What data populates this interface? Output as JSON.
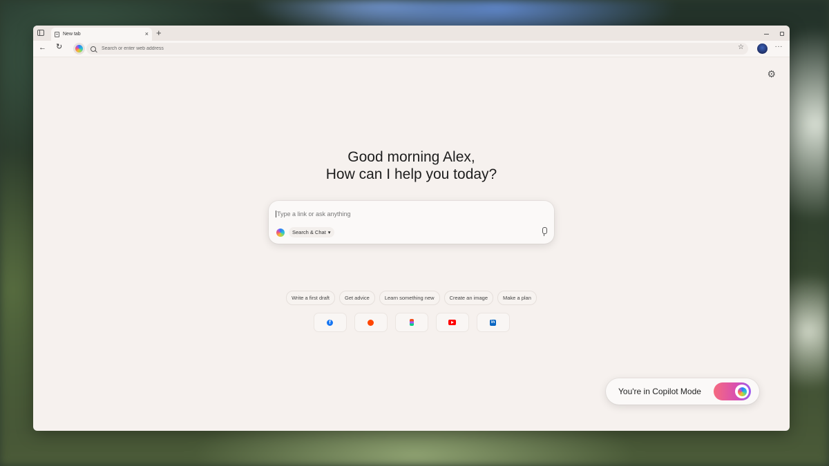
{
  "tab": {
    "title": "New tab",
    "close": "×",
    "new_tab": "+"
  },
  "toolbar": {
    "back": "←",
    "refresh": "↻",
    "address_placeholder": "Search or enter web address",
    "favorites": "☆",
    "more": "···"
  },
  "page": {
    "settings": "⚙",
    "greeting_line1": "Good morning Alex,",
    "greeting_line2": "How can I help you today?"
  },
  "chat": {
    "placeholder": "Type a link or ask anything",
    "mode_label": "Search & Chat",
    "mode_caret": "▾"
  },
  "suggestions": [
    "Write a first draft",
    "Get advice",
    "Learn something new",
    "Create an image",
    "Make a plan"
  ],
  "shortcuts": [
    "facebook",
    "reddit",
    "figma",
    "youtube",
    "linkedin"
  ],
  "copilot_mode": {
    "label": "You're in Copilot Mode",
    "enabled": true
  },
  "colors": {
    "page_bg": "#f6f1ee",
    "toggle_start": "#f56a7f",
    "toggle_end": "#9b5cf0"
  }
}
